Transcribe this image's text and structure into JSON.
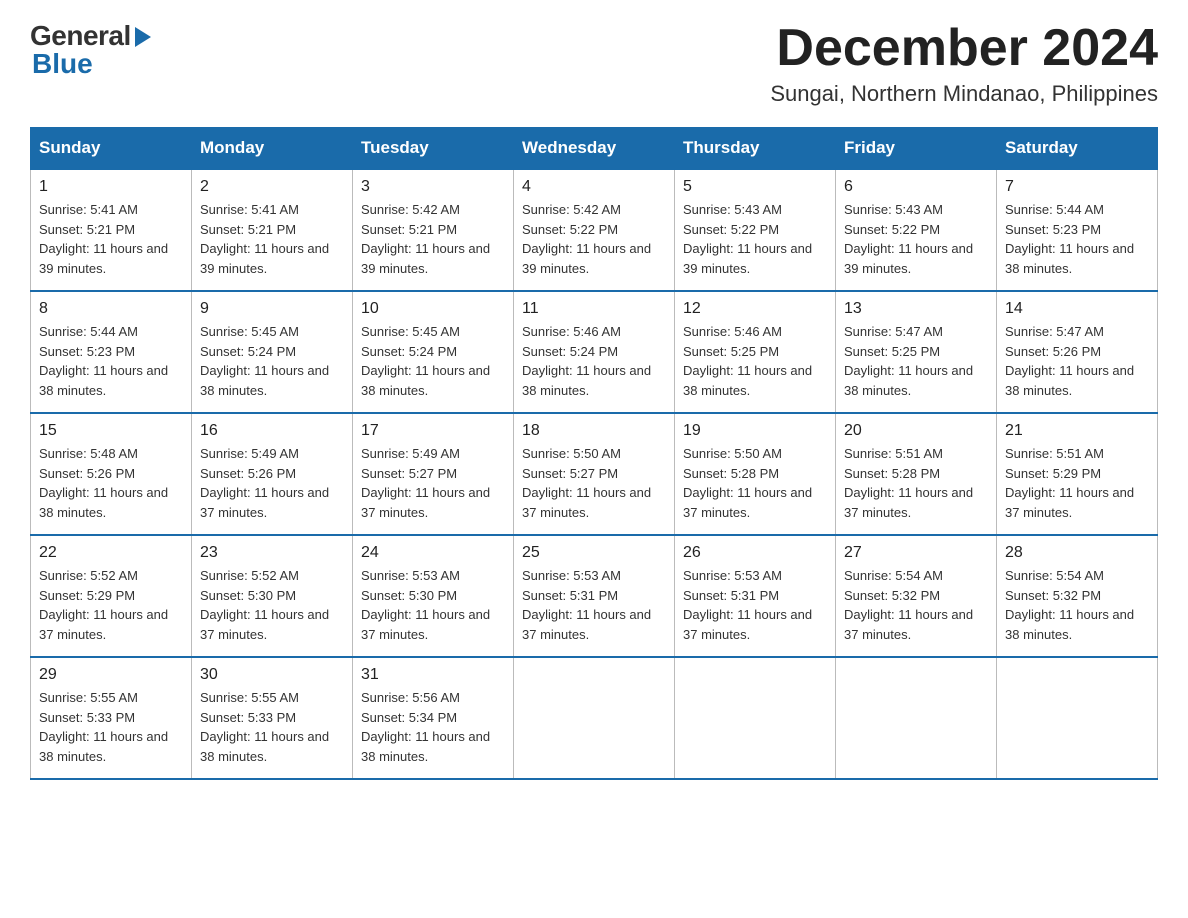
{
  "header": {
    "logo_general": "General",
    "logo_blue": "Blue",
    "month_title": "December 2024",
    "location": "Sungai, Northern Mindanao, Philippines"
  },
  "days_of_week": [
    "Sunday",
    "Monday",
    "Tuesday",
    "Wednesday",
    "Thursday",
    "Friday",
    "Saturday"
  ],
  "weeks": [
    [
      {
        "day": "1",
        "sunrise": "Sunrise: 5:41 AM",
        "sunset": "Sunset: 5:21 PM",
        "daylight": "Daylight: 11 hours and 39 minutes."
      },
      {
        "day": "2",
        "sunrise": "Sunrise: 5:41 AM",
        "sunset": "Sunset: 5:21 PM",
        "daylight": "Daylight: 11 hours and 39 minutes."
      },
      {
        "day": "3",
        "sunrise": "Sunrise: 5:42 AM",
        "sunset": "Sunset: 5:21 PM",
        "daylight": "Daylight: 11 hours and 39 minutes."
      },
      {
        "day": "4",
        "sunrise": "Sunrise: 5:42 AM",
        "sunset": "Sunset: 5:22 PM",
        "daylight": "Daylight: 11 hours and 39 minutes."
      },
      {
        "day": "5",
        "sunrise": "Sunrise: 5:43 AM",
        "sunset": "Sunset: 5:22 PM",
        "daylight": "Daylight: 11 hours and 39 minutes."
      },
      {
        "day": "6",
        "sunrise": "Sunrise: 5:43 AM",
        "sunset": "Sunset: 5:22 PM",
        "daylight": "Daylight: 11 hours and 39 minutes."
      },
      {
        "day": "7",
        "sunrise": "Sunrise: 5:44 AM",
        "sunset": "Sunset: 5:23 PM",
        "daylight": "Daylight: 11 hours and 38 minutes."
      }
    ],
    [
      {
        "day": "8",
        "sunrise": "Sunrise: 5:44 AM",
        "sunset": "Sunset: 5:23 PM",
        "daylight": "Daylight: 11 hours and 38 minutes."
      },
      {
        "day": "9",
        "sunrise": "Sunrise: 5:45 AM",
        "sunset": "Sunset: 5:24 PM",
        "daylight": "Daylight: 11 hours and 38 minutes."
      },
      {
        "day": "10",
        "sunrise": "Sunrise: 5:45 AM",
        "sunset": "Sunset: 5:24 PM",
        "daylight": "Daylight: 11 hours and 38 minutes."
      },
      {
        "day": "11",
        "sunrise": "Sunrise: 5:46 AM",
        "sunset": "Sunset: 5:24 PM",
        "daylight": "Daylight: 11 hours and 38 minutes."
      },
      {
        "day": "12",
        "sunrise": "Sunrise: 5:46 AM",
        "sunset": "Sunset: 5:25 PM",
        "daylight": "Daylight: 11 hours and 38 minutes."
      },
      {
        "day": "13",
        "sunrise": "Sunrise: 5:47 AM",
        "sunset": "Sunset: 5:25 PM",
        "daylight": "Daylight: 11 hours and 38 minutes."
      },
      {
        "day": "14",
        "sunrise": "Sunrise: 5:47 AM",
        "sunset": "Sunset: 5:26 PM",
        "daylight": "Daylight: 11 hours and 38 minutes."
      }
    ],
    [
      {
        "day": "15",
        "sunrise": "Sunrise: 5:48 AM",
        "sunset": "Sunset: 5:26 PM",
        "daylight": "Daylight: 11 hours and 38 minutes."
      },
      {
        "day": "16",
        "sunrise": "Sunrise: 5:49 AM",
        "sunset": "Sunset: 5:26 PM",
        "daylight": "Daylight: 11 hours and 37 minutes."
      },
      {
        "day": "17",
        "sunrise": "Sunrise: 5:49 AM",
        "sunset": "Sunset: 5:27 PM",
        "daylight": "Daylight: 11 hours and 37 minutes."
      },
      {
        "day": "18",
        "sunrise": "Sunrise: 5:50 AM",
        "sunset": "Sunset: 5:27 PM",
        "daylight": "Daylight: 11 hours and 37 minutes."
      },
      {
        "day": "19",
        "sunrise": "Sunrise: 5:50 AM",
        "sunset": "Sunset: 5:28 PM",
        "daylight": "Daylight: 11 hours and 37 minutes."
      },
      {
        "day": "20",
        "sunrise": "Sunrise: 5:51 AM",
        "sunset": "Sunset: 5:28 PM",
        "daylight": "Daylight: 11 hours and 37 minutes."
      },
      {
        "day": "21",
        "sunrise": "Sunrise: 5:51 AM",
        "sunset": "Sunset: 5:29 PM",
        "daylight": "Daylight: 11 hours and 37 minutes."
      }
    ],
    [
      {
        "day": "22",
        "sunrise": "Sunrise: 5:52 AM",
        "sunset": "Sunset: 5:29 PM",
        "daylight": "Daylight: 11 hours and 37 minutes."
      },
      {
        "day": "23",
        "sunrise": "Sunrise: 5:52 AM",
        "sunset": "Sunset: 5:30 PM",
        "daylight": "Daylight: 11 hours and 37 minutes."
      },
      {
        "day": "24",
        "sunrise": "Sunrise: 5:53 AM",
        "sunset": "Sunset: 5:30 PM",
        "daylight": "Daylight: 11 hours and 37 minutes."
      },
      {
        "day": "25",
        "sunrise": "Sunrise: 5:53 AM",
        "sunset": "Sunset: 5:31 PM",
        "daylight": "Daylight: 11 hours and 37 minutes."
      },
      {
        "day": "26",
        "sunrise": "Sunrise: 5:53 AM",
        "sunset": "Sunset: 5:31 PM",
        "daylight": "Daylight: 11 hours and 37 minutes."
      },
      {
        "day": "27",
        "sunrise": "Sunrise: 5:54 AM",
        "sunset": "Sunset: 5:32 PM",
        "daylight": "Daylight: 11 hours and 37 minutes."
      },
      {
        "day": "28",
        "sunrise": "Sunrise: 5:54 AM",
        "sunset": "Sunset: 5:32 PM",
        "daylight": "Daylight: 11 hours and 38 minutes."
      }
    ],
    [
      {
        "day": "29",
        "sunrise": "Sunrise: 5:55 AM",
        "sunset": "Sunset: 5:33 PM",
        "daylight": "Daylight: 11 hours and 38 minutes."
      },
      {
        "day": "30",
        "sunrise": "Sunrise: 5:55 AM",
        "sunset": "Sunset: 5:33 PM",
        "daylight": "Daylight: 11 hours and 38 minutes."
      },
      {
        "day": "31",
        "sunrise": "Sunrise: 5:56 AM",
        "sunset": "Sunset: 5:34 PM",
        "daylight": "Daylight: 11 hours and 38 minutes."
      },
      null,
      null,
      null,
      null
    ]
  ]
}
